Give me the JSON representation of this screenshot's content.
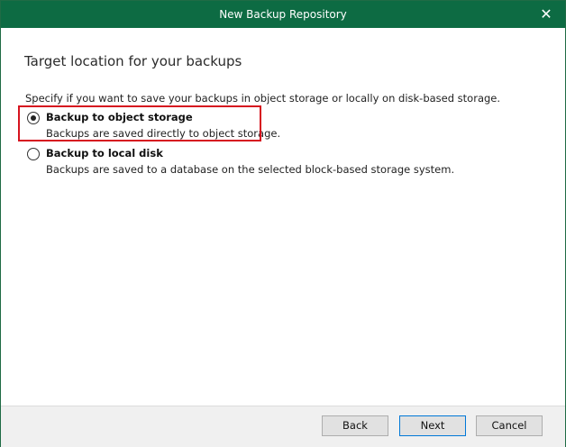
{
  "window": {
    "title": "New Backup Repository",
    "close_symbol": "✕"
  },
  "page": {
    "heading": "Target location for your backups",
    "instructions": "Specify if you want to save your backups in object storage or locally on disk-based storage."
  },
  "options": [
    {
      "title": "Backup to object storage",
      "description": "Backups are saved directly to object storage.",
      "selected": true
    },
    {
      "title": "Backup to local disk",
      "description": "Backups are saved to a database on the selected block-based storage system.",
      "selected": false
    }
  ],
  "footer": {
    "back_label": "Back",
    "next_label": "Next",
    "cancel_label": "Cancel"
  },
  "colors": {
    "titlebar": "#0d6b43",
    "highlight": "#d6131f"
  }
}
